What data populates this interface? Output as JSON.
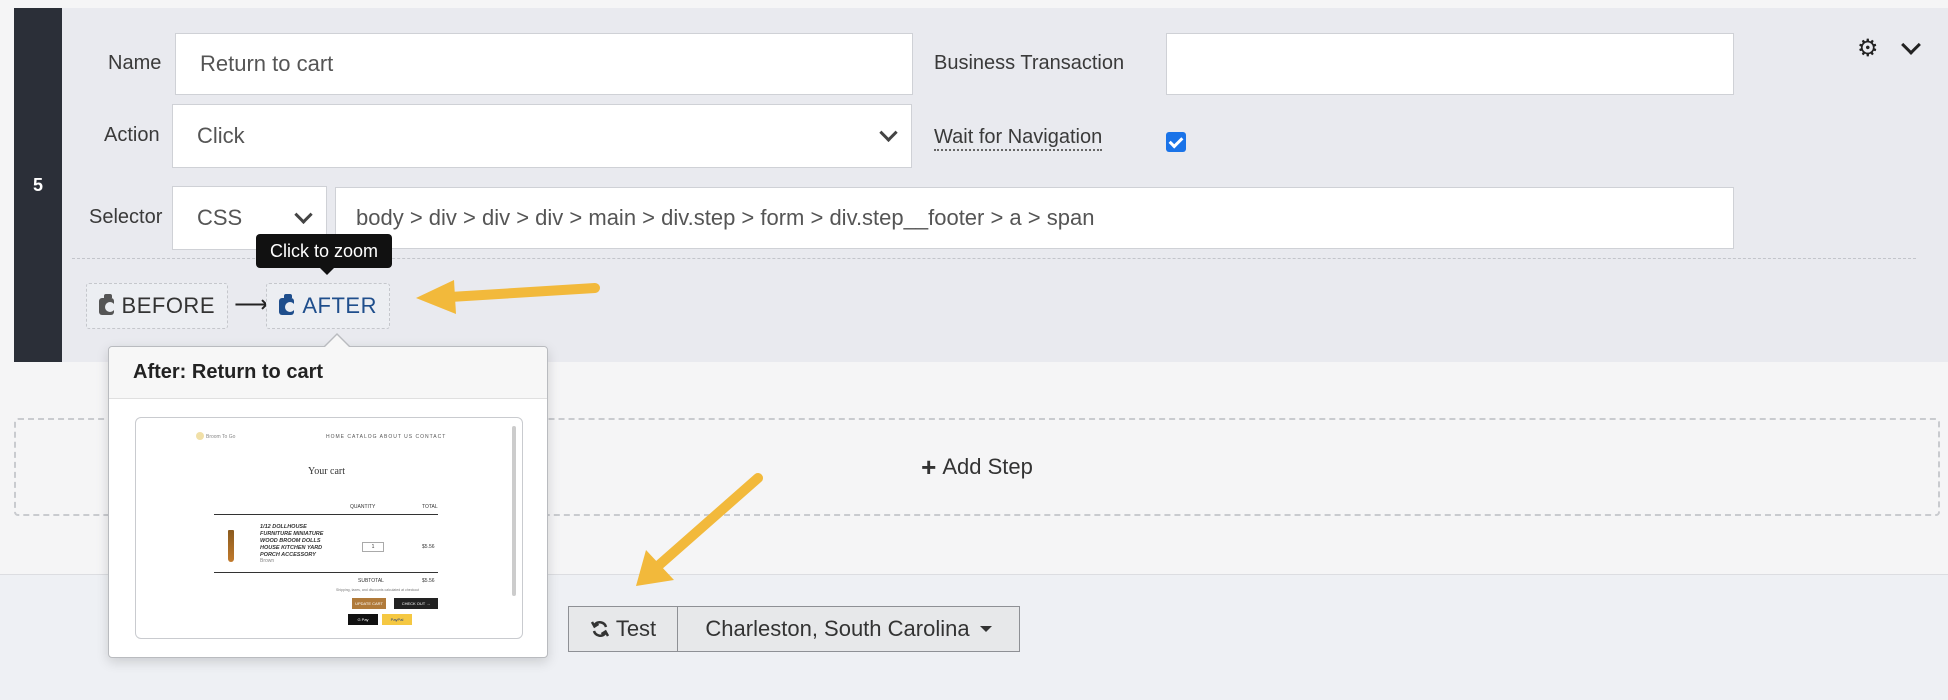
{
  "step": {
    "number": "5",
    "name_label": "Name",
    "name_value": "Return to cart",
    "business_transaction_label": "Business Transaction",
    "business_transaction_value": "",
    "action_label": "Action",
    "action_value": "Click",
    "wait_for_navigation_label": "Wait for Navigation",
    "wait_for_navigation_checked": true,
    "selector_label": "Selector",
    "selector_type": "CSS",
    "selector_value": "body > div > div > div > main > div.step > form > div.step__footer > a > span",
    "before_label": "BEFORE",
    "after_label": "AFTER",
    "arrow_glyph": "⟶",
    "tooltip": "Click to zoom",
    "settings_icon": "gear-icon",
    "collapse_icon": "chevron-down-icon"
  },
  "popover": {
    "title": "After: Return to cart",
    "thumbnail": {
      "logo_text": "Broom To Go",
      "nav": "HOME   CATALOG   ABOUT US   CONTACT",
      "title": "Your cart",
      "quantity_header": "QUANTITY",
      "total_header": "TOTAL",
      "product": "1/12 DOLLHOUSE FURNITURE MINIATURE WOOD BROOM DOLLS HOUSE KITCHEN YARD PORCH ACCESSORY",
      "product_variant": "Brown",
      "quantity": "1",
      "line_total": "$5.56",
      "subtotal_label": "SUBTOTAL",
      "subtotal": "$5.56",
      "note": "Shipping, taxes, and discounts calculated at checkout",
      "update_label": "UPDATE CART",
      "checkout_label": "CHECK OUT →",
      "gpay": "G Pay",
      "paypal": "PayPal"
    }
  },
  "add_step": {
    "icon": "+",
    "label": "Add Step"
  },
  "footer": {
    "test_icon": "refresh-icon",
    "test_label": "Test",
    "location": "Charleston, South Carolina"
  },
  "colors": {
    "accent": "#1f4e8c",
    "annotation_arrow": "#f2b93b",
    "step_bar": "#2b2f38",
    "panel_bg": "#e9eaef"
  }
}
